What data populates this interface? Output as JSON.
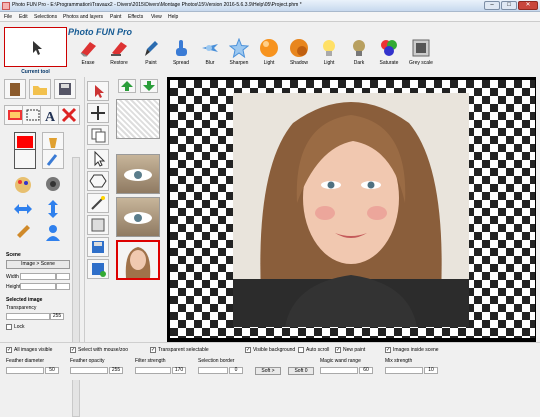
{
  "window": {
    "title": "Photo FUN Pro - E:\\Programmation\\Travaux2 - Divers\\2015\\Divers\\Montage Photos\\15\\Version 2016-5.6.3.9\\Help\\05\\Project.phm *",
    "minimize": "–",
    "maximize": "□",
    "close": "✕"
  },
  "menu": {
    "items": [
      "File",
      "Edit",
      "Selections",
      "Photos and layers",
      "Paint",
      "Effects",
      "View",
      "Help"
    ]
  },
  "toolbar": {
    "current_tool_label": "Current tool",
    "app_name": "Photo FUN Pro",
    "tools": [
      "Erase",
      "Restore",
      "Paint",
      "Spread",
      "Blur",
      "Sharpen",
      "Light",
      "Shadow",
      "Light",
      "Dark",
      "Saturate",
      "Grey scale"
    ]
  },
  "panel": {
    "scene_label": "Scene",
    "image_scene_button": "Image > Scene",
    "width_label": "Width",
    "height_label": "Height",
    "width_value": "",
    "height_value": "",
    "selected_image_label": "Selected image",
    "transparency_label": "Transparency",
    "transparency_value": "255",
    "lock_label": "Lock"
  },
  "status": {
    "all_images_visible": "All images visible",
    "select_with_mouse": "Select with mouse/zoo",
    "transparent_selectable": "Transparent selectable",
    "visible_background": "Visible background",
    "auto_scroll": "Auto scroll",
    "new_paint": "New paint",
    "images_inside_scene": "Images inside scene",
    "feather_diameter": "Feather diameter",
    "feather_opacity": "Feather opacity",
    "filter_strength": "Filter strength",
    "selection_border": "Selection border",
    "magic_wand_range": "Magic wand range",
    "mix_strength": "Mix strength",
    "feather_diameter_value": "50",
    "feather_opacity_value": "255",
    "filter_strength_value": "170",
    "selection_border_value": "0",
    "magic_wand_value": "60",
    "mix_strength_value": "10",
    "soft_button": "Soft >",
    "soft_value": "Soft 0"
  },
  "colors": {
    "accent": "#155a93",
    "primary_color": "#ff0000",
    "secondary_color": "#ffffff"
  }
}
